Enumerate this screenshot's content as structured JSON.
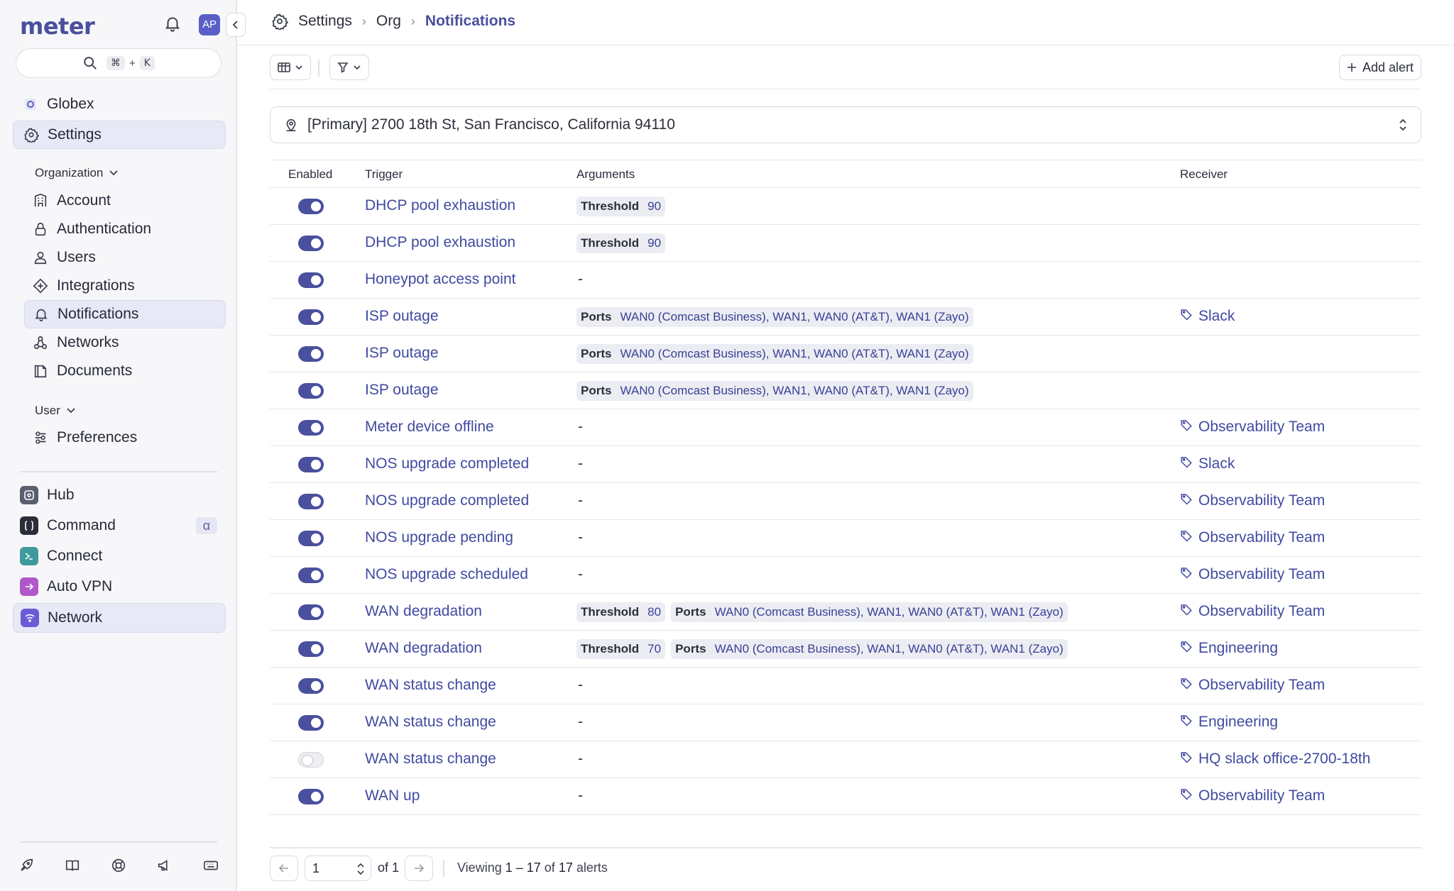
{
  "sidebar": {
    "logo": "meter",
    "avatar": "AP",
    "search_kbd": [
      "⌘",
      "+",
      "K"
    ],
    "org_name": "Globex",
    "settings_label": "Settings",
    "organization_label": "Organization",
    "org_items": [
      {
        "label": "Account",
        "icon": "building-icon"
      },
      {
        "label": "Authentication",
        "icon": "lock-icon"
      },
      {
        "label": "Users",
        "icon": "user-icon"
      },
      {
        "label": "Integrations",
        "icon": "integrations-icon"
      },
      {
        "label": "Notifications",
        "icon": "bell-icon"
      },
      {
        "label": "Networks",
        "icon": "network-icon"
      },
      {
        "label": "Documents",
        "icon": "documents-icon"
      }
    ],
    "user_label": "User",
    "user_items": [
      {
        "label": "Preferences",
        "icon": "preferences-icon"
      }
    ],
    "apps": [
      {
        "label": "Hub",
        "color": "#5b5e6e"
      },
      {
        "label": "Command",
        "color": "#2b2d38",
        "badge": "α"
      },
      {
        "label": "Connect",
        "color": "#3e9a9c"
      },
      {
        "label": "Auto VPN",
        "color": "#b057c9"
      },
      {
        "label": "Network",
        "color": "#6b5cd6"
      }
    ]
  },
  "breadcrumb": {
    "items": [
      "Settings",
      "Org",
      "Notifications"
    ]
  },
  "toolbar": {
    "add_alert_label": "Add alert"
  },
  "location": "[Primary] 2700 18th St, San Francisco, California 94110",
  "table": {
    "headers": {
      "enabled": "Enabled",
      "trigger": "Trigger",
      "arguments": "Arguments",
      "receiver": "Receiver"
    },
    "rows": [
      {
        "enabled": true,
        "trigger": "DHCP pool exhaustion",
        "args": [
          {
            "k": "Threshold",
            "v": "90"
          }
        ],
        "receiver": ""
      },
      {
        "enabled": true,
        "trigger": "DHCP pool exhaustion",
        "args": [
          {
            "k": "Threshold",
            "v": "90"
          }
        ],
        "receiver": ""
      },
      {
        "enabled": true,
        "trigger": "Honeypot access point",
        "args": [],
        "receiver": ""
      },
      {
        "enabled": true,
        "trigger": "ISP outage",
        "args": [
          {
            "k": "Ports",
            "v": "WAN0 (Comcast Business), WAN1, WAN0 (AT&T), WAN1 (Zayo)"
          }
        ],
        "receiver": "Slack"
      },
      {
        "enabled": true,
        "trigger": "ISP outage",
        "args": [
          {
            "k": "Ports",
            "v": "WAN0 (Comcast Business), WAN1, WAN0 (AT&T), WAN1 (Zayo)"
          }
        ],
        "receiver": ""
      },
      {
        "enabled": true,
        "trigger": "ISP outage",
        "args": [
          {
            "k": "Ports",
            "v": "WAN0 (Comcast Business), WAN1, WAN0 (AT&T), WAN1 (Zayo)"
          }
        ],
        "receiver": ""
      },
      {
        "enabled": true,
        "trigger": "Meter device offline",
        "args": [],
        "receiver": "Observability Team"
      },
      {
        "enabled": true,
        "trigger": "NOS upgrade completed",
        "args": [],
        "receiver": "Slack"
      },
      {
        "enabled": true,
        "trigger": "NOS upgrade completed",
        "args": [],
        "receiver": "Observability Team"
      },
      {
        "enabled": true,
        "trigger": "NOS upgrade pending",
        "args": [],
        "receiver": "Observability Team"
      },
      {
        "enabled": true,
        "trigger": "NOS upgrade scheduled",
        "args": [],
        "receiver": "Observability Team"
      },
      {
        "enabled": true,
        "trigger": "WAN degradation",
        "args": [
          {
            "k": "Threshold",
            "v": "80"
          },
          {
            "k": "Ports",
            "v": "WAN0 (Comcast Business), WAN1, WAN0 (AT&T), WAN1 (Zayo)"
          }
        ],
        "receiver": "Observability Team"
      },
      {
        "enabled": true,
        "trigger": "WAN degradation",
        "args": [
          {
            "k": "Threshold",
            "v": "70"
          },
          {
            "k": "Ports",
            "v": "WAN0 (Comcast Business), WAN1, WAN0 (AT&T), WAN1 (Zayo)"
          }
        ],
        "receiver": "Engineering"
      },
      {
        "enabled": true,
        "trigger": "WAN status change",
        "args": [],
        "receiver": "Observability Team"
      },
      {
        "enabled": true,
        "trigger": "WAN status change",
        "args": [],
        "receiver": "Engineering"
      },
      {
        "enabled": false,
        "trigger": "WAN status change",
        "args": [],
        "receiver": "HQ slack office-2700-18th"
      },
      {
        "enabled": true,
        "trigger": "WAN up",
        "args": [],
        "receiver": "Observability Team"
      }
    ],
    "empty_dash": "-"
  },
  "pagination": {
    "page": "1",
    "of_total": "of 1",
    "viewing_prefix": "Viewing",
    "range": "1 – 17",
    "of": "of",
    "total": "17",
    "suffix": "alerts"
  },
  "colors": {
    "accent": "#4a4f9e",
    "link": "#404aa0"
  }
}
